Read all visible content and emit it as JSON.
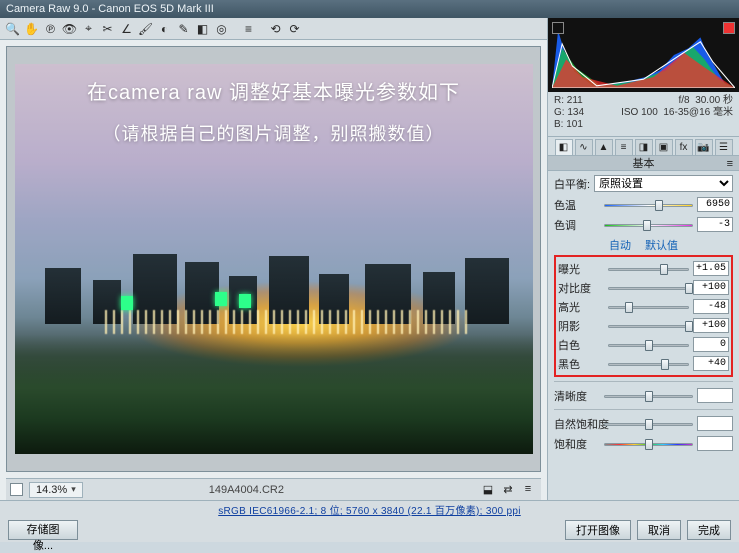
{
  "title": "Camera Raw 9.0  -  Canon EOS 5D Mark III",
  "overlay": {
    "line1": "在camera raw 调整好基本曝光参数如下",
    "line2": "（请根据自己的图片调整，别照搬数值）"
  },
  "zoom": "14.3%",
  "filename": "149A4004.CR2",
  "readout": {
    "r": "R:  211",
    "g": "G:  134",
    "b": "B:  101",
    "aperture": "f/8",
    "shutter": "30.00 秒",
    "iso": "ISO 100",
    "lens": "16-35@16 毫米"
  },
  "panel_title": "基本",
  "wb": {
    "label": "白平衡:",
    "value": "原照设置"
  },
  "sliders": {
    "temp": {
      "label": "色温",
      "value": "6950",
      "pos": 62
    },
    "tint": {
      "label": "色调",
      "value": "-3",
      "pos": 48
    },
    "expo": {
      "label": "曝光",
      "value": "+1.05",
      "pos": 69
    },
    "contr": {
      "label": "对比度",
      "value": "+100",
      "pos": 100
    },
    "high": {
      "label": "高光",
      "value": "-48",
      "pos": 26
    },
    "shad": {
      "label": "阴影",
      "value": "+100",
      "pos": 100
    },
    "white": {
      "label": "白色",
      "value": "0",
      "pos": 50
    },
    "black": {
      "label": "黑色",
      "value": "+40",
      "pos": 70
    },
    "clar": {
      "label": "清晰度",
      "value": "",
      "pos": 50
    },
    "vib": {
      "label": "自然饱和度",
      "value": "",
      "pos": 50
    },
    "sat": {
      "label": "饱和度",
      "value": "",
      "pos": 50
    }
  },
  "links": {
    "auto": "自动",
    "default": "默认值"
  },
  "footer": {
    "link": "sRGB IEC61966-2.1; 8 位; 5760 x 3840 (22.1 百万像素); 300 ppi",
    "save": "存储图像...",
    "open": "打开图像",
    "cancel": "取消",
    "done": "完成"
  },
  "icons": [
    "🔍",
    "✋",
    "⊕",
    "👁",
    "✂",
    "⌖",
    "✎",
    "⌫",
    "↺",
    "🖌",
    "◧",
    "⬚",
    "◐",
    "✶",
    "≡",
    "⟳",
    "⟲"
  ]
}
